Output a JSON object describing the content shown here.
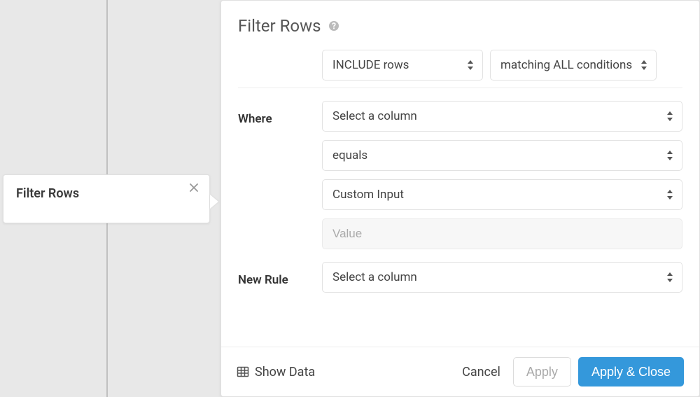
{
  "node": {
    "title": "Filter Rows"
  },
  "panel": {
    "title": "Filter Rows",
    "include_mode": "INCLUDE rows",
    "match_mode": "matching ALL conditions",
    "where_label": "Where",
    "new_rule_label": "New Rule",
    "rule": {
      "column": "Select a column",
      "operator": "equals",
      "input_type": "Custom Input",
      "value_placeholder": "Value"
    },
    "new_rule_column": "Select a column"
  },
  "footer": {
    "show_data": "Show Data",
    "cancel": "Cancel",
    "apply": "Apply",
    "apply_close": "Apply & Close"
  }
}
